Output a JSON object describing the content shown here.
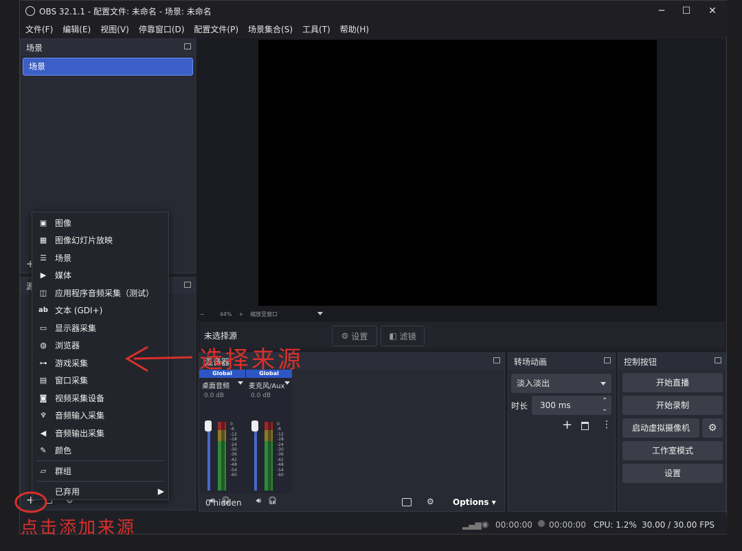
{
  "window": {
    "title": "OBS 32.1.1 - 配置文件: 未命名 - 场景: 未命名"
  },
  "menu": [
    "文件(F)",
    "编辑(E)",
    "视图(V)",
    "停靠窗口(D)",
    "配置文件(P)",
    "场景集合(S)",
    "工具(T)",
    "帮助(H)"
  ],
  "scenes": {
    "title": "场景",
    "items": [
      "场景"
    ]
  },
  "sources": {
    "title": "源"
  },
  "zoom": {
    "minus": "−",
    "value": "44%",
    "plus": "+",
    "placeholder": "缩放至窗口"
  },
  "context_bar": {
    "no_source": "未选择源",
    "settings": "设置",
    "filters": "滤镜"
  },
  "mixer": {
    "title": "混音器",
    "channels": [
      {
        "global": "Global",
        "name": "桌面音频",
        "db": "0.0 dB"
      },
      {
        "global": "Global",
        "name": "麦克风/Aux",
        "db": "0.0 dB"
      }
    ],
    "scale": [
      "0",
      "-6",
      "-12",
      "-18",
      "-24",
      "-30",
      "-36",
      "-42",
      "-48",
      "-54",
      "-60"
    ],
    "hidden": "0 hidden",
    "options": "Options"
  },
  "transitions": {
    "title": "转场动画",
    "selected": "淡入淡出",
    "duration_label": "时长",
    "duration": "300 ms"
  },
  "controls": {
    "title": "控制按钮",
    "buttons": [
      "开始直播",
      "开始录制",
      "启动虚拟摄像机",
      "工作室模式",
      "设置"
    ]
  },
  "status": {
    "time1": "00:00:00",
    "time2": "00:00:00",
    "cpu": "CPU: 1.2%",
    "fps": "30.00 / 30.00 FPS"
  },
  "context_menu": {
    "items": [
      {
        "label": "图像",
        "icon": "image-icon"
      },
      {
        "label": "图像幻灯片放映",
        "icon": "slideshow-icon"
      },
      {
        "label": "场景",
        "icon": "list-icon"
      },
      {
        "label": "媒体",
        "icon": "play-icon"
      },
      {
        "label": "应用程序音频采集（测试）",
        "icon": "app-audio-icon"
      },
      {
        "label": "文本 (GDI+)",
        "icon": "text-icon"
      },
      {
        "label": "显示器采集",
        "icon": "monitor-icon"
      },
      {
        "label": "浏览器",
        "icon": "globe-icon"
      },
      {
        "label": "游戏采集",
        "icon": "gamepad-icon"
      },
      {
        "label": "窗口采集",
        "icon": "window-icon"
      },
      {
        "label": "视频采集设备",
        "icon": "camera-icon"
      },
      {
        "label": "音频输入采集",
        "icon": "microphone-icon"
      },
      {
        "label": "音频输出采集",
        "icon": "speaker-icon"
      },
      {
        "label": "颜色",
        "icon": "brush-icon"
      }
    ],
    "group": "群组",
    "deprecated": "已弃用"
  },
  "annotations": {
    "choose_source": "选择来源",
    "click_add": "点击添加来源"
  },
  "colors": {
    "accent": "#3b5fc6",
    "annotation": "#d9302b"
  }
}
